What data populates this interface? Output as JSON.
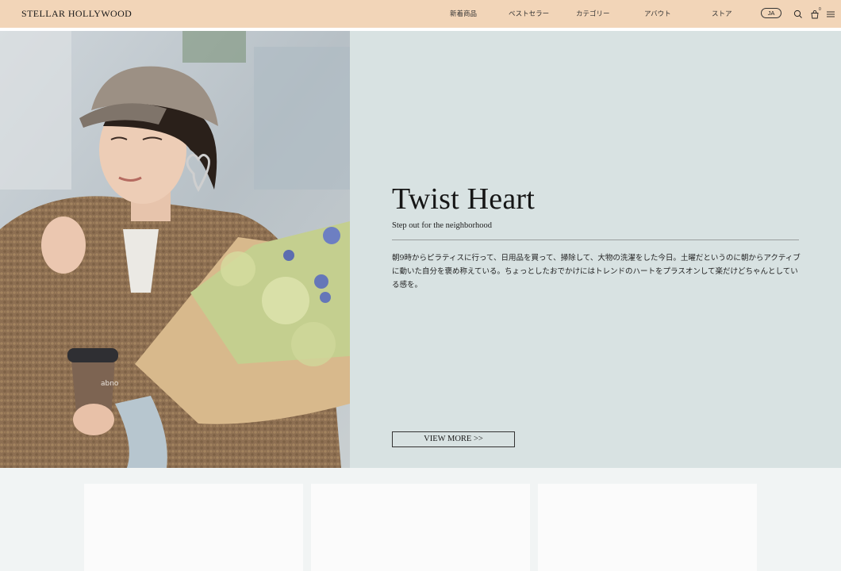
{
  "header": {
    "brand": "STELLAR HOLLYWOOD",
    "nav": [
      {
        "label": "新着商品"
      },
      {
        "label": "ベストセラー"
      },
      {
        "label": "カテゴリー"
      },
      {
        "label": "アバウト"
      },
      {
        "label": "ストア"
      }
    ],
    "language": "JA",
    "cart_count": "0",
    "icons": {
      "search": "search-icon",
      "cart": "cart-icon",
      "menu": "menu-icon"
    }
  },
  "hero": {
    "title": "Twist Heart",
    "subtitle": "Step out for the neighborhood",
    "body": "朝9時からピラティスに行って、日用品を買って、掃除して、大物の洗濯をした今日。土曜だというのに朝からアクティブに動いた自分を褒め称えている。ちょっとしたおでかけにはトレンドのハートをプラスオンして楽だけどちゃんとしている感を。",
    "cta": "VIEW MORE >>",
    "cup_text": "abno"
  },
  "colors": {
    "header_bg": "#f2d5b8",
    "panel_bg": "#d8e2e2",
    "page_bg": "#f1f4f4"
  }
}
